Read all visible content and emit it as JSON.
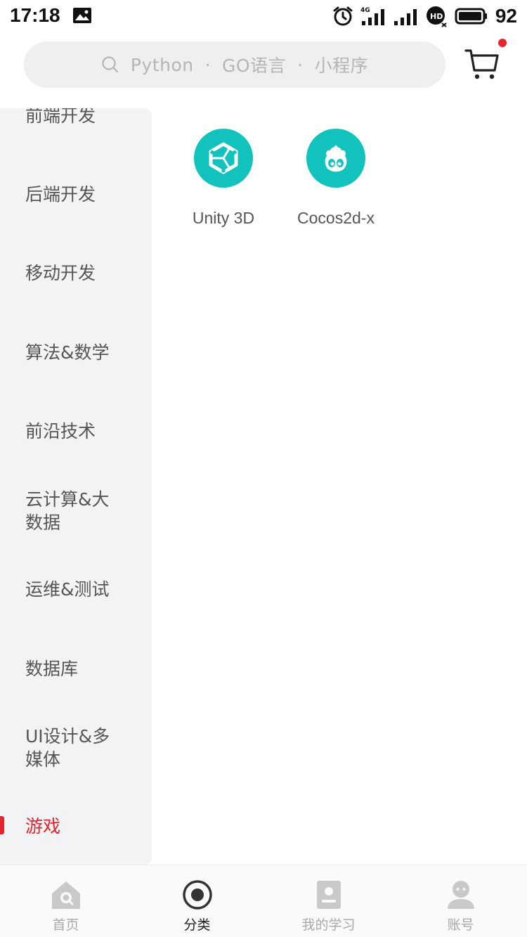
{
  "status_bar": {
    "time": "17:18",
    "network": "4G",
    "battery": "92"
  },
  "search": {
    "keywords": [
      "Python",
      "GO语言",
      "小程序"
    ],
    "separator": "·"
  },
  "cart": {
    "has_badge": true
  },
  "sidebar": {
    "items": [
      {
        "label": "前端开发"
      },
      {
        "label": "后端开发"
      },
      {
        "label": "移动开发"
      },
      {
        "label": "算法&数学"
      },
      {
        "label": "前沿技术"
      },
      {
        "label": "云计算&大数据"
      },
      {
        "label": "运维&测试"
      },
      {
        "label": "数据库"
      },
      {
        "label": "UI设计&多媒体"
      },
      {
        "label": "游戏"
      }
    ],
    "active_index": 9
  },
  "categories": [
    {
      "label": "Unity 3D",
      "icon": "unity-icon"
    },
    {
      "label": "Cocos2d-x",
      "icon": "cocos-icon"
    }
  ],
  "bottom_nav": {
    "items": [
      {
        "label": "首页",
        "icon": "home-icon"
      },
      {
        "label": "分类",
        "icon": "category-icon"
      },
      {
        "label": "我的学习",
        "icon": "my-learning-icon"
      },
      {
        "label": "账号",
        "icon": "account-icon"
      }
    ],
    "active_index": 1
  },
  "colors": {
    "accent": "#e8222b",
    "teal": "#12c3bd",
    "sidebar_bg": "#f2f3f5"
  }
}
